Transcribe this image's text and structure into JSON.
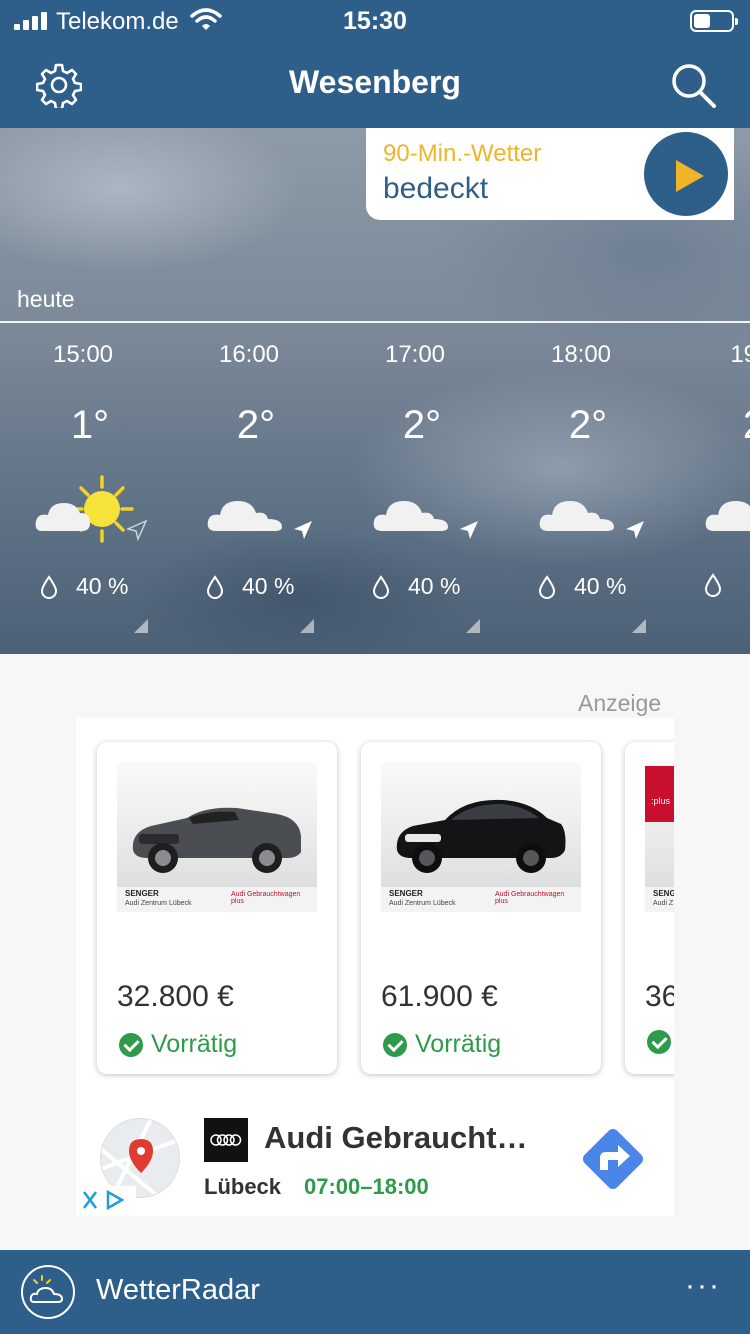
{
  "status_bar": {
    "carrier": "Telekom.de",
    "time": "15:30"
  },
  "header": {
    "title": "Wesenberg"
  },
  "nowcast": {
    "label": "90-Min.-Wetter",
    "condition": "bedeckt"
  },
  "forecast": {
    "day_label": "heute",
    "hours": [
      {
        "time": "15:00",
        "temp": "1°",
        "icon": "sun-cloud-icon",
        "precip": "40 %"
      },
      {
        "time": "16:00",
        "temp": "2°",
        "icon": "cloud-icon",
        "precip": "40 %"
      },
      {
        "time": "17:00",
        "temp": "2°",
        "icon": "cloud-icon",
        "precip": "40 %"
      },
      {
        "time": "18:00",
        "temp": "2°",
        "icon": "cloud-icon",
        "precip": "40 %"
      },
      {
        "time": "19:",
        "temp": "2",
        "icon": "cloud-icon",
        "precip": ""
      }
    ]
  },
  "ad": {
    "label": "Anzeige",
    "cards": [
      {
        "price": "32.800 €",
        "stock": "Vorrätig",
        "dealer": "SENGER",
        "dealer_sub": "Audi Zentrum Lübeck",
        "badge": "Audi Gebrauchtwagen plus"
      },
      {
        "price": "61.900 €",
        "stock": "Vorrätig",
        "dealer": "SENGER",
        "dealer_sub": "Audi Zentrum Lübeck",
        "badge": "Audi Gebrauchtwagen plus"
      },
      {
        "price": "36",
        "stock": "",
        "dealer": "SENGER",
        "dealer_sub": "Audi Z",
        "badge": ":plus"
      }
    ],
    "place": {
      "name": "Audi Gebraucht…",
      "city": "Lübeck",
      "hours": "07:00–18:00"
    }
  },
  "bottom_bar": {
    "title": "WetterRadar",
    "more": "···"
  },
  "colors": {
    "primary": "#2e5f8a",
    "accent": "#f0b429",
    "in_stock": "#2e9b4a"
  }
}
